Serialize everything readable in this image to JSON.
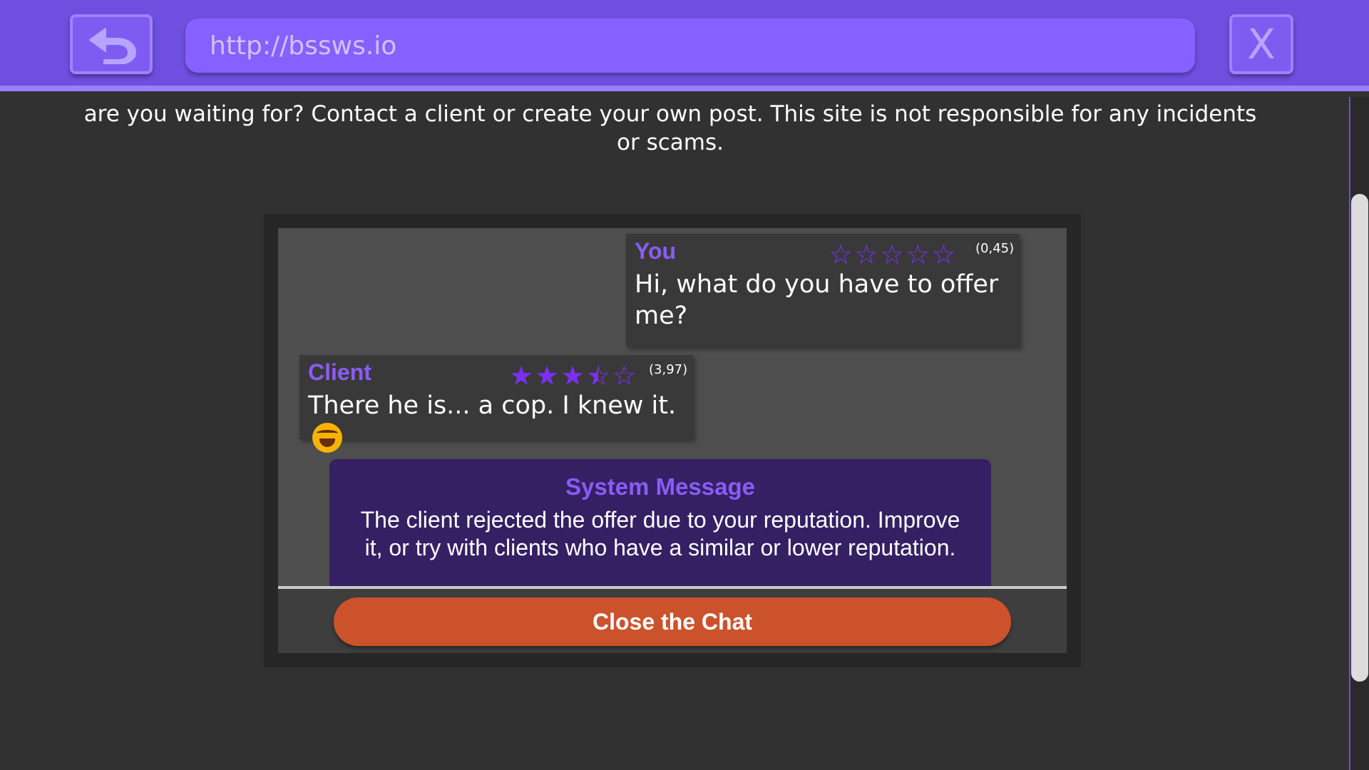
{
  "browser": {
    "url": "http://bssws.io",
    "close_label": "X"
  },
  "page": {
    "intro_text": "are you waiting for? Contact a client or create your own post. This site is not responsible for any incidents or scams."
  },
  "chat": {
    "messages": [
      {
        "sender": "You",
        "rating_value": 0.45,
        "rating_label": "(0,45)",
        "text": "Hi, what do you have to offer me?"
      },
      {
        "sender": "Client",
        "rating_value": 3.97,
        "rating_label": "(3,97)",
        "text": "There he is... a cop. I knew it.",
        "emoji": "rolling-on-floor-laughing-emoji"
      }
    ],
    "system_message": {
      "title": "System Message",
      "text": "The client rejected the offer due to your reputation. Improve it, or try with clients who have a similar or lower reputation."
    },
    "close_button": "Close the Chat"
  },
  "colors": {
    "topbar": "#6f4fe0",
    "accent": "#8a5cf6",
    "star": "#7b2ff2",
    "system_bg": "#342063",
    "close_button": "#cc522c"
  }
}
